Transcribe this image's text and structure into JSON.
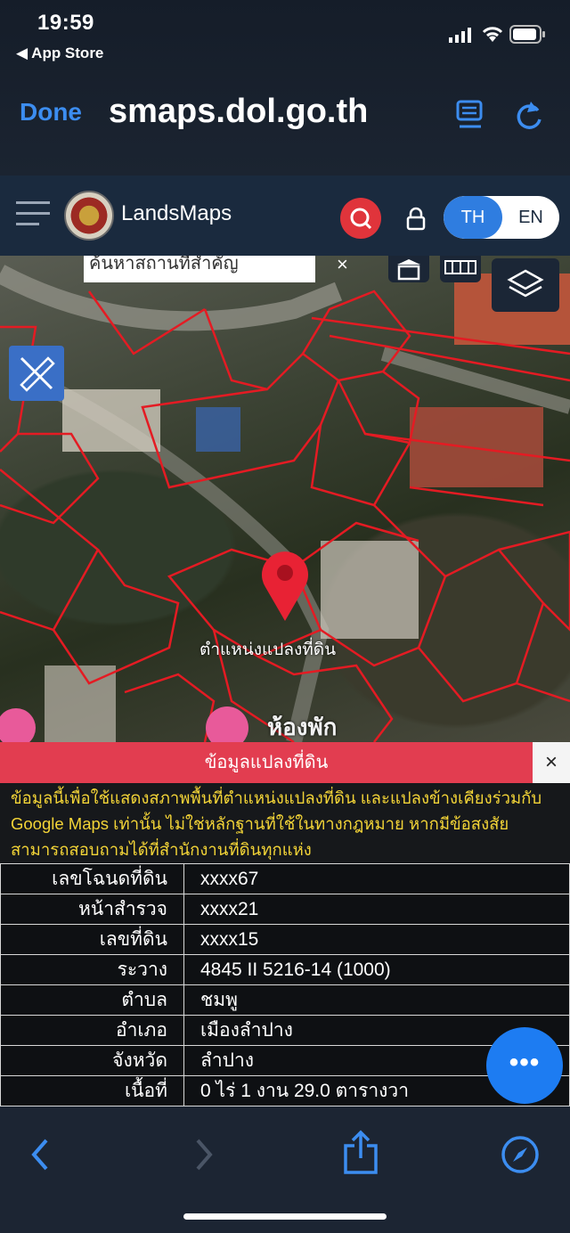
{
  "status_bar": {
    "time": "19:59",
    "back_app": "◀ App Store"
  },
  "safari": {
    "done_label": "Done",
    "url": "smaps.dol.go.th"
  },
  "header": {
    "title": "LandsMaps",
    "lang_th": "TH",
    "lang_en": "EN"
  },
  "map": {
    "search_placeholder": "ค้นหาสถานที่สำคัญ",
    "pin_label": "ตำแหน่งแปลงที่ดิน",
    "place_label": "ห้องพัก",
    "parcel_line_color": "#e41b23"
  },
  "panel": {
    "title": "ข้อมูลแปลงที่ดิน",
    "close": "×",
    "disclaimer": "ข้อมูลนี้เพื่อใช้แสดงสภาพพื้นที่ตำแหน่งแปลงที่ดิน และแปลงข้างเคียงร่วมกับ Google Maps เท่านั้น ไม่ใช่หลักฐานที่ใช้ในทางกฎหมาย หากมีข้อสงสัยสามารถสอบถามได้ที่สำนักงานที่ดินทุกแห่ง",
    "rows": [
      {
        "label": "เลขโฉนดที่ดิน",
        "value": "xxxx67"
      },
      {
        "label": "หน้าสำรวจ",
        "value": "xxxx21"
      },
      {
        "label": "เลขที่ดิน",
        "value": "xxxx15"
      },
      {
        "label": "ระวาง",
        "value": "4845 II 5216-14 (1000)"
      },
      {
        "label": "ตำบล",
        "value": "ชมพู"
      },
      {
        "label": "อำเภอ",
        "value": "เมืองลำปาง"
      },
      {
        "label": "จังหวัด",
        "value": "ลำปาง"
      },
      {
        "label": "เนื้อที่",
        "value": "0 ไร่ 1 งาน 29.0 ตารางวา"
      }
    ],
    "fab_label": "•••"
  },
  "colors": {
    "accent": "#2f7de0",
    "panel_red": "#e23d50",
    "disclaimer_yellow": "#f3d437"
  }
}
